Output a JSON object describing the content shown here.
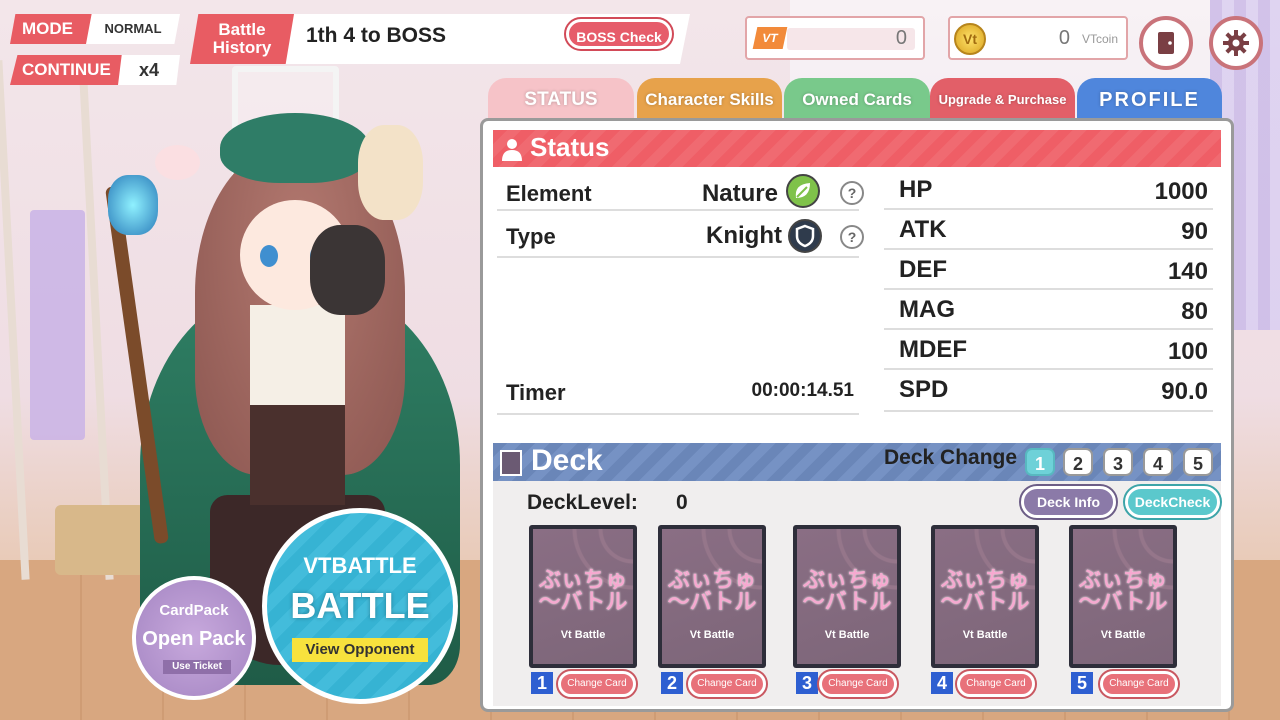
{
  "hud": {
    "mode_label": "MODE",
    "mode_value": "NORMAL",
    "continue_label": "CONTINUE",
    "continue_value": "x4",
    "battle_history_label": "Battle History",
    "battle_history_text": "1th 4 to BOSS",
    "boss_check_label": "BOSS Check"
  },
  "currency": {
    "vt_label": "VT",
    "vt_value": "0",
    "coin_icon_text": "Vt",
    "coin_value": "0",
    "coin_unit": "VTcoin"
  },
  "tabs": [
    {
      "label": "STATUS"
    },
    {
      "label": "Character Skills"
    },
    {
      "label": "Owned Cards"
    },
    {
      "label": "Upgrade & Purchase"
    },
    {
      "label": "PROFILE"
    }
  ],
  "status": {
    "title": "Status",
    "element_label": "Element",
    "element_value": "Nature",
    "type_label": "Type",
    "type_value": "Knight",
    "help_glyph": "?",
    "timer_label": "Timer",
    "timer_value": "00:00:14.51",
    "stats": [
      {
        "label": "HP",
        "value": "1000"
      },
      {
        "label": "ATK",
        "value": "90"
      },
      {
        "label": "DEF",
        "value": "140"
      },
      {
        "label": "MAG",
        "value": "80"
      },
      {
        "label": "MDEF",
        "value": "100"
      },
      {
        "label": "SPD",
        "value": "90.0"
      }
    ]
  },
  "deck": {
    "title": "Deck",
    "change_label": "Deck Change",
    "deck_numbers": [
      "1",
      "2",
      "3",
      "4",
      "5"
    ],
    "active_deck": "1",
    "level_label": "DeckLevel:",
    "level_value": "0",
    "info_button": "Deck Info",
    "check_button": "DeckCheck",
    "cards": [
      {
        "index": "1",
        "logo": "ぶぃちゅ～バトル",
        "sub": "Vt Battle",
        "button": "Change Card"
      },
      {
        "index": "2",
        "logo": "ぶぃちゅ～バトル",
        "sub": "Vt Battle",
        "button": "Change Card"
      },
      {
        "index": "3",
        "logo": "ぶぃちゅ～バトル",
        "sub": "Vt Battle",
        "button": "Change Card"
      },
      {
        "index": "4",
        "logo": "ぶぃちゅ～バトル",
        "sub": "Vt Battle",
        "button": "Change Card"
      },
      {
        "index": "5",
        "logo": "ぶぃちゅ～バトル",
        "sub": "Vt Battle",
        "button": "Change Card"
      }
    ]
  },
  "cardpack": {
    "title": "CardPack",
    "action": "Open Pack",
    "ticket": "Use Ticket"
  },
  "battle": {
    "top": "VTBATTLE",
    "main": "BATTLE",
    "view": "View Opponent"
  },
  "colors": {
    "accent_red": "#e85c63",
    "deck_blue": "#6a86b8",
    "battle_cyan": "#36b3d3",
    "cardpack_purple": "#a485c2"
  },
  "icons": {
    "door": "door-icon",
    "gear": "gear-icon",
    "nature": "leaf-icon",
    "knight": "shield-icon"
  }
}
